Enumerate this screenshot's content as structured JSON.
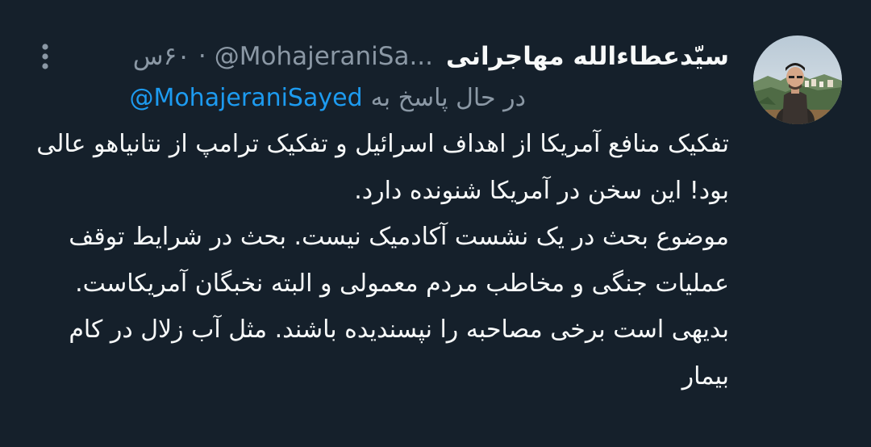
{
  "tweet": {
    "display_name": "سیّدعطاءالله مهاجرانی",
    "handle": "@MohajeraniSa...",
    "separator": "·",
    "time": "۶۰س",
    "reply_label": "در حال پاسخ به",
    "reply_to": "@MohajeraniSayed",
    "text": "تفکیک منافع آمریکا از اهداف اسرائیل و تفکیک ترامپ از نتانیاهو عالی بود! این سخن در آمریکا شنونده دارد.\nموضوع بحث در یک نشست آکادمیک نیست. بحث در شرایط توقف عملیات جنگی و مخاطب مردم معمولی و البته نخبگان آمریکاست.\nبدیهی است برخی مصاحبه را نپسندیده باشند. مثل آب زلال در کام بیمار",
    "icons": {
      "avatar": "profile-photo",
      "more": "more-vertical-icon"
    },
    "colors": {
      "background": "#15202b",
      "text": "#f7f9f9",
      "secondary": "#8b98a5",
      "link": "#1d9bf0"
    }
  }
}
